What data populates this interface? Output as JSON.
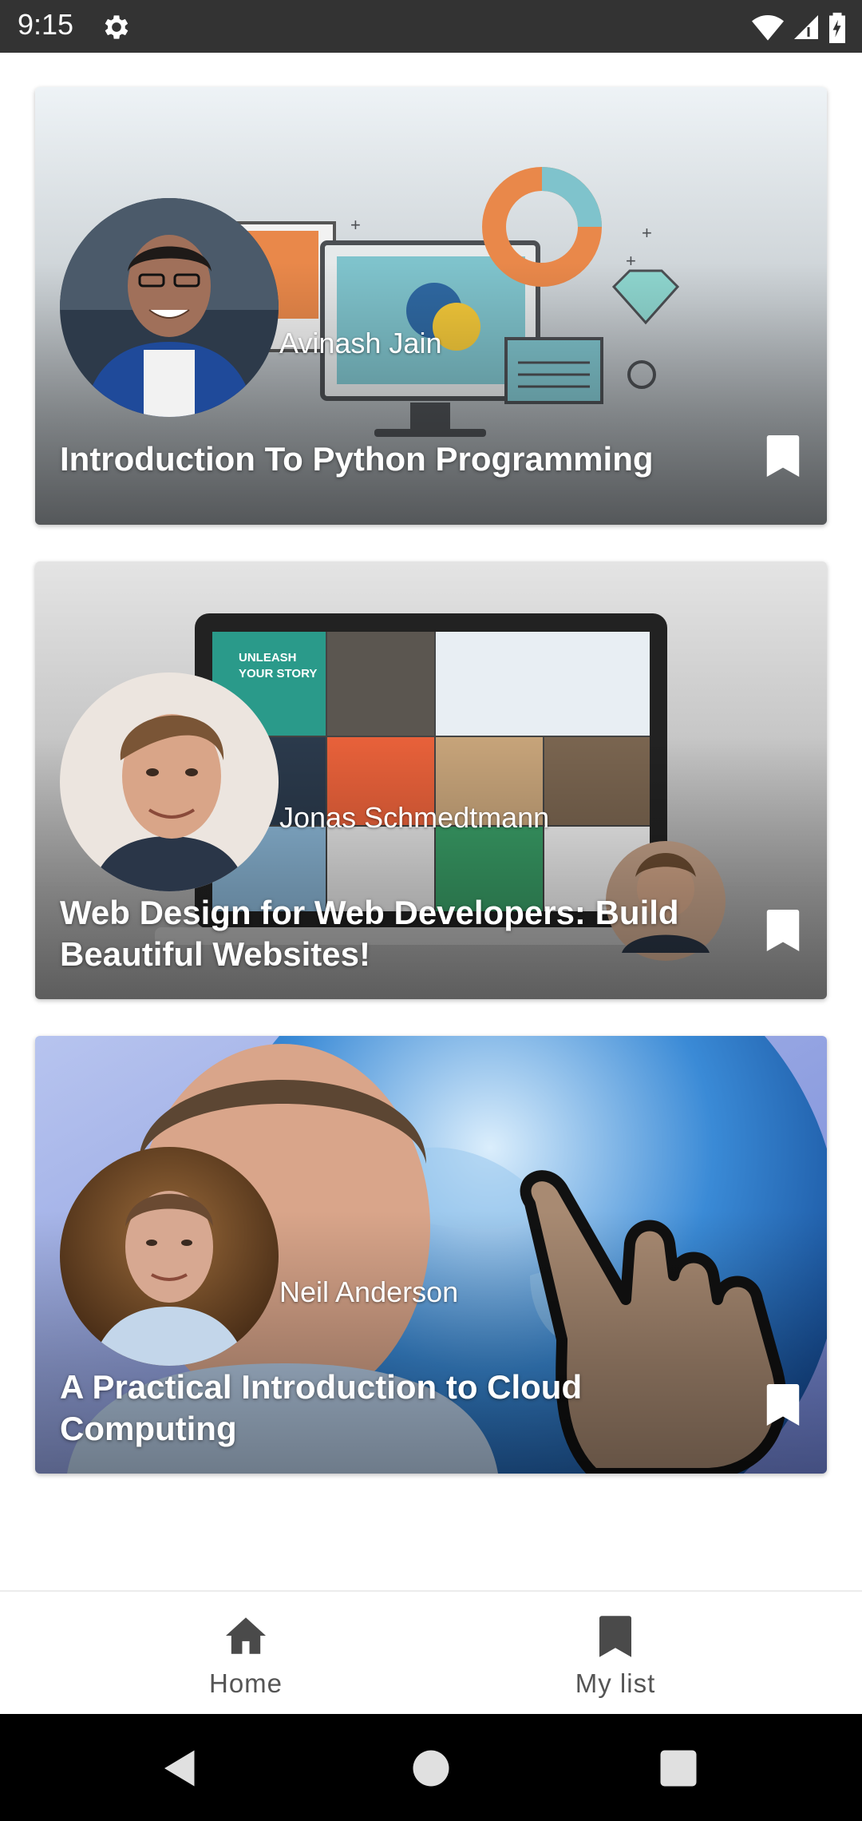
{
  "status_bar": {
    "time": "9:15",
    "icons": [
      "settings-gear-icon",
      "wifi-icon",
      "signal-icon",
      "battery-icon"
    ]
  },
  "courses": [
    {
      "instructor": "Avinash Jain",
      "title": "Introduction To Python Programming",
      "bookmark_icon": "bookmark-icon"
    },
    {
      "instructor": "Jonas Schmedtmann",
      "title": "Web Design for Web Developers: Build Beautiful Websites!",
      "bookmark_icon": "bookmark-icon"
    },
    {
      "instructor": "Neil Anderson",
      "title": "A Practical Introduction to Cloud Computing",
      "bookmark_icon": "bookmark-icon"
    }
  ],
  "bottom_nav": {
    "items": [
      {
        "label": "Home",
        "icon": "home-icon"
      },
      {
        "label": "My list",
        "icon": "bookmark-icon"
      }
    ]
  },
  "system_nav": {
    "buttons": [
      "back-icon",
      "home-circle-icon",
      "recents-square-icon"
    ]
  },
  "colors": {
    "status_bar": "#333333",
    "nav_text": "#555555",
    "nav_icon": "#4a4a4a"
  }
}
